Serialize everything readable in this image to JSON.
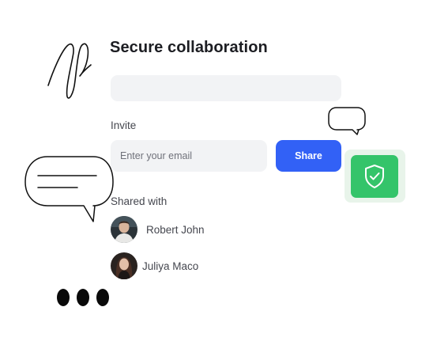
{
  "colors": {
    "accent": "#3261f6",
    "field_bg": "#f2f3f5",
    "success": "#34c46a",
    "text_dark": "#1c1d22"
  },
  "header": {
    "title": "Secure collaboration"
  },
  "invite": {
    "label": "Invite",
    "email_placeholder": "Enter your email",
    "email_value": "",
    "share_label": "Share"
  },
  "shared": {
    "label": "Shared with",
    "users": [
      {
        "name": "Robert John",
        "avatar": "avatar-photo"
      },
      {
        "name": "Juliya Maco",
        "avatar": "avatar-photo"
      }
    ]
  },
  "decorations": {
    "icons": [
      "signature-doodle",
      "speech-bubble-icon",
      "chat-bubble-icon",
      "shield-check-icon",
      "ellipsis-dots-icon"
    ]
  }
}
